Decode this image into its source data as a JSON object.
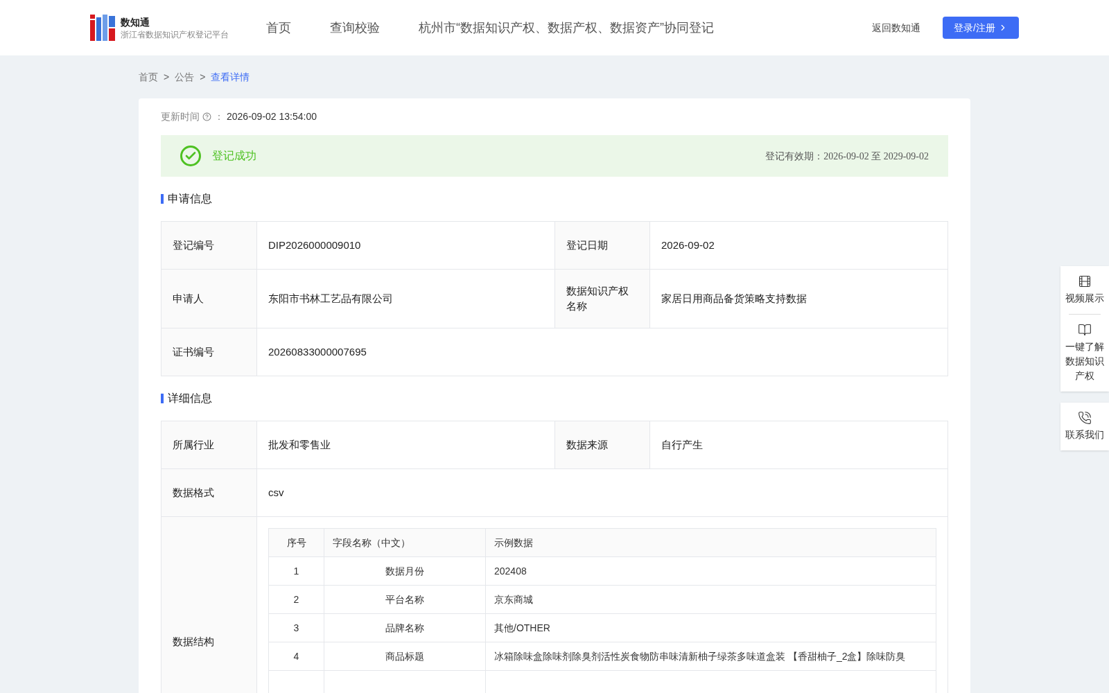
{
  "header": {
    "logo_title": "数知通",
    "logo_subtitle": "浙江省数据知识产权登记平台",
    "nav": [
      {
        "label": "首页",
        "selected": false
      },
      {
        "label": "查询校验",
        "selected": false
      },
      {
        "label": "杭州市“数据知识产权、数据产权、数据资产”协同登记",
        "selected": false
      }
    ],
    "back_link": "返回数知通",
    "login_button": "登录/注册"
  },
  "breadcrumb": [
    {
      "label": "首页",
      "selected": false
    },
    {
      "label": "公告",
      "selected": false
    },
    {
      "label": "查看详情",
      "selected": true
    }
  ],
  "breadcrumb_separator": ">",
  "update": {
    "label": "更新时间",
    "colon": "：",
    "value": "2026-09-02 13:54:00"
  },
  "status": {
    "text": "登记成功",
    "validity": "登记有效期：2026-09-02 至 2029-09-02"
  },
  "application_section": {
    "title": "申请信息",
    "rows": [
      [
        {
          "label": "登记编号",
          "value": "DIP2026000009010"
        },
        {
          "label": "登记日期",
          "value": "2026-09-02"
        }
      ],
      [
        {
          "label": "申请人",
          "value": "东阳市书林工艺品有限公司"
        },
        {
          "label": "数据知识产权名称",
          "value": "家居日用商品备货策略支持数据"
        }
      ],
      [
        {
          "label": "证书编号",
          "value": "20260833000007695"
        }
      ]
    ]
  },
  "detail_section": {
    "title": "详细信息",
    "rows": [
      [
        {
          "label": "所属行业",
          "value": "批发和零售业"
        },
        {
          "label": "数据来源",
          "value": "自行产生"
        }
      ],
      [
        {
          "label": "数据格式",
          "value": "csv"
        }
      ]
    ],
    "structure_label": "数据结构",
    "structure_table": {
      "columns": [
        "序号",
        "字段名称（中文）",
        "示例数据"
      ],
      "rows": [
        [
          "1",
          "数据月份",
          "202408"
        ],
        [
          "2",
          "平台名称",
          "京东商城"
        ],
        [
          "3",
          "品牌名称",
          "其他/OTHER"
        ],
        [
          "4",
          "商品标题",
          "冰箱除味盒除味剂除臭剂活性炭食物防串味清新柚子绿茶多味道盒装 【香甜柚子_2盒】除味防臭"
        ]
      ]
    }
  },
  "float_panel": [
    {
      "kind": "video",
      "label": "视频展示"
    },
    {
      "kind": "book",
      "label": "一键了解数据知识产权"
    },
    {
      "kind": "phone",
      "label": "联系我们"
    }
  ]
}
